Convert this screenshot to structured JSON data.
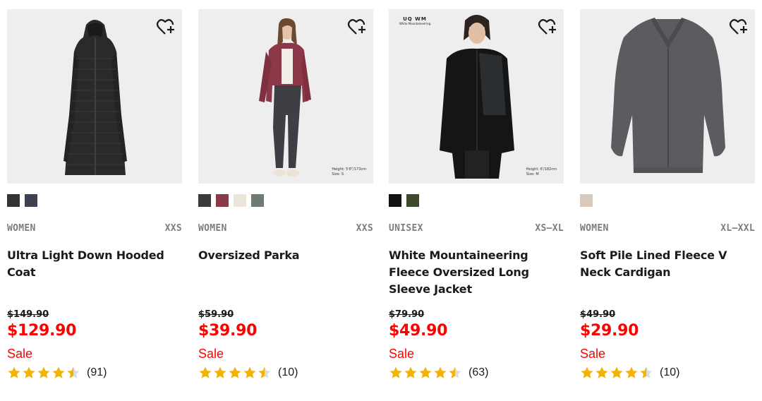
{
  "colors": {
    "sale_red": "#ff0000",
    "star_gold": "#f5b301",
    "image_bg": "#eeeeee",
    "meta_gray": "#7d7d7d"
  },
  "products": [
    {
      "gender": "WOMEN",
      "sizes": "XXS",
      "title": "Ultra Light Down Hooded Coat",
      "original_price": "$149.90",
      "price": "$129.90",
      "sale_label": "Sale",
      "rating": 4.5,
      "review_count": "(91)",
      "swatches": [
        "#333333",
        "#3d4152"
      ],
      "image_icon": "black-hooded-down-coat-image",
      "model_info": [
        "",
        ""
      ],
      "badge": null
    },
    {
      "gender": "WOMEN",
      "sizes": "XXS",
      "title": "Oversized Parka",
      "original_price": "$59.90",
      "price": "$39.90",
      "sale_label": "Sale",
      "rating": 4.5,
      "review_count": "(10)",
      "swatches": [
        "#3a3a3d",
        "#8b3a4a",
        "#ece6d8",
        "#6e7a72"
      ],
      "image_icon": "woman-in-burgundy-parka-image",
      "model_info": [
        "Height: 5'8\"/173cm",
        "Size: S"
      ],
      "badge": null
    },
    {
      "gender": "UNISEX",
      "sizes": "XS–XL",
      "title": "White Mountaineering Fleece Oversized Long Sleeve Jacket",
      "original_price": "$79.90",
      "price": "$49.90",
      "sale_label": "Sale",
      "rating": 4.5,
      "review_count": "(63)",
      "swatches": [
        "#111111",
        "#3f4a2c"
      ],
      "image_icon": "man-in-black-fleece-jacket-image",
      "model_info": [
        "Height: 6'/182cm",
        "Size: M"
      ],
      "badge": {
        "logo": "UQ WM",
        "name": "White Mountaineering"
      }
    },
    {
      "gender": "WOMEN",
      "sizes": "XL–XXL",
      "title": "Soft Pile Lined Fleece V Neck Cardigan",
      "original_price": "$49.90",
      "price": "$29.90",
      "sale_label": "Sale",
      "rating": 4.5,
      "review_count": "(10)",
      "swatches": [
        "#d8cbbd"
      ],
      "image_icon": "gray-fleece-cardigan-image",
      "model_info": [
        "",
        ""
      ],
      "badge": null
    }
  ]
}
